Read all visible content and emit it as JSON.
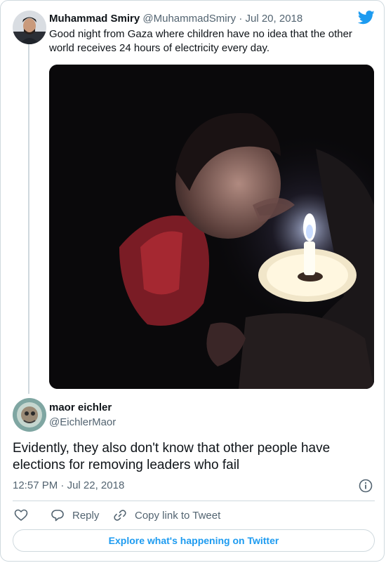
{
  "quoted_tweet": {
    "author_name": "Muhammad Smiry",
    "author_handle": "@MuhammadSmiry",
    "separator": "·",
    "date": "Jul 20, 2018",
    "text": "Good night from Gaza where children have no idea that the other world receives 24 hours of electricity every day."
  },
  "reply_tweet": {
    "author_name": "maor eichler",
    "author_handle": "@EichlerMaor",
    "text": "Evidently, they also don't know that other people have elections for removing leaders who fail",
    "time": "12:57 PM",
    "separator": "·",
    "date": "Jul 22, 2018"
  },
  "actions": {
    "reply_label": "Reply",
    "copy_link_label": "Copy link to Tweet"
  },
  "explore_label": "Explore what's happening on Twitter",
  "icons": {
    "brand": "twitter-bird-icon",
    "like": "heart-icon",
    "reply": "speech-bubble-icon",
    "copy": "link-icon",
    "info": "info-icon"
  },
  "colors": {
    "accent": "#1d9bf0",
    "text": "#0f1419",
    "secondary": "#536471",
    "border": "#cfd9de"
  }
}
